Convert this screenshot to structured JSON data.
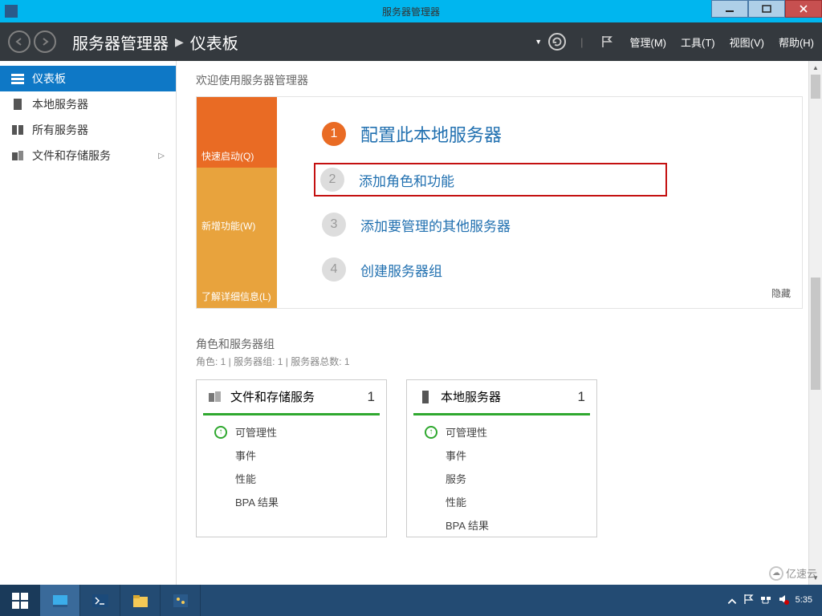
{
  "titlebar": {
    "title": "服务器管理器"
  },
  "breadcrumb": {
    "app": "服务器管理器",
    "page": "仪表板"
  },
  "header_menu": {
    "manage": "管理(M)",
    "tools": "工具(T)",
    "view": "视图(V)",
    "help": "帮助(H)"
  },
  "sidebar": {
    "items": [
      {
        "label": "仪表板",
        "icon": "dashboard-icon",
        "active": true
      },
      {
        "label": "本地服务器",
        "icon": "server-icon"
      },
      {
        "label": "所有服务器",
        "icon": "servers-icon"
      },
      {
        "label": "文件和存储服务",
        "icon": "storage-icon",
        "expandable": true
      }
    ]
  },
  "welcome": {
    "heading": "欢迎使用服务器管理器",
    "tabs": {
      "quick": "快速启动(Q)",
      "whatsnew": "新增功能(W)",
      "learn": "了解详细信息(L)"
    },
    "steps": {
      "s1": "配置此本地服务器",
      "s2": "添加角色和功能",
      "s3": "添加要管理的其他服务器",
      "s4": "创建服务器组"
    },
    "hide": "隐藏"
  },
  "roles": {
    "heading": "角色和服务器组",
    "sub": "角色: 1 | 服务器组: 1 | 服务器总数: 1",
    "tiles": [
      {
        "title": "文件和存储服务",
        "count": "1",
        "rows": [
          "可管理性",
          "事件",
          "性能",
          "BPA 结果"
        ]
      },
      {
        "title": "本地服务器",
        "count": "1",
        "rows": [
          "可管理性",
          "事件",
          "服务",
          "性能",
          "BPA 结果"
        ]
      }
    ]
  },
  "tray": {
    "time": "5:35"
  },
  "watermark": "亿速云"
}
